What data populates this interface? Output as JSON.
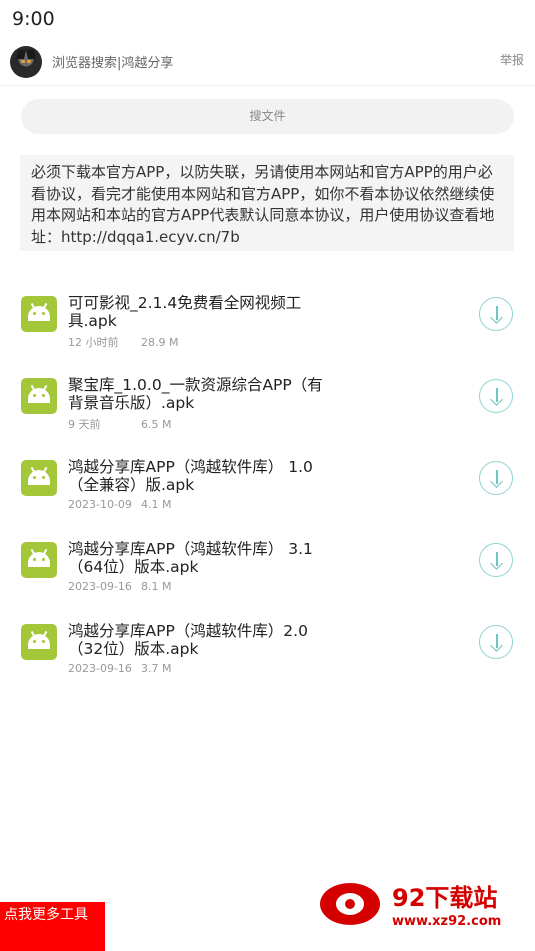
{
  "status_bar": {
    "time": "9:00"
  },
  "header": {
    "title": "浏览器搜索|鸿越分享",
    "report_label": "举报"
  },
  "search": {
    "label": "搜文件"
  },
  "notice": {
    "text": "必须下载本官方APP，以防失联，另请使用本网站和官方APP的用户必看协议，看完才能使用本网站和官方APP，如你不看本协议依然继续使用本网站和本站的官方APP代表默认同意本协议，用户使用协议查看地址：http://dqqa1.ecyv.cn/7b"
  },
  "files": [
    {
      "name": "可可影视_2.1.4免费看全网视频工具.apk",
      "time": "12 小时前",
      "size": "28.9 M"
    },
    {
      "name": "聚宝库_1.0.0_一款资源综合APP（有背景音乐版）.apk",
      "time": "9 天前",
      "size": "6.5 M"
    },
    {
      "name": "鸿越分享库APP（鸿越软件库） 1.0（全兼容）版.apk",
      "time": "2023-10-09",
      "size": "4.1 M"
    },
    {
      "name": "鸿越分享库APP（鸿越软件库） 3.1（64位）版本.apk",
      "time": "2023-09-16",
      "size": "8.1 M"
    },
    {
      "name": "鸿越分享库APP（鸿越软件库）2.0（32位）版本.apk",
      "time": "2023-09-16",
      "size": "3.7 M"
    }
  ],
  "more_tools": {
    "label": "点我更多工具"
  },
  "watermark": {
    "title": "92下载站",
    "url": "www.xz92.com"
  },
  "colors": {
    "accent": "#6cc5bf",
    "android": "#a4c639",
    "promo_red": "#ff0000"
  },
  "icons": {
    "file": "android-icon",
    "download": "download-icon"
  }
}
